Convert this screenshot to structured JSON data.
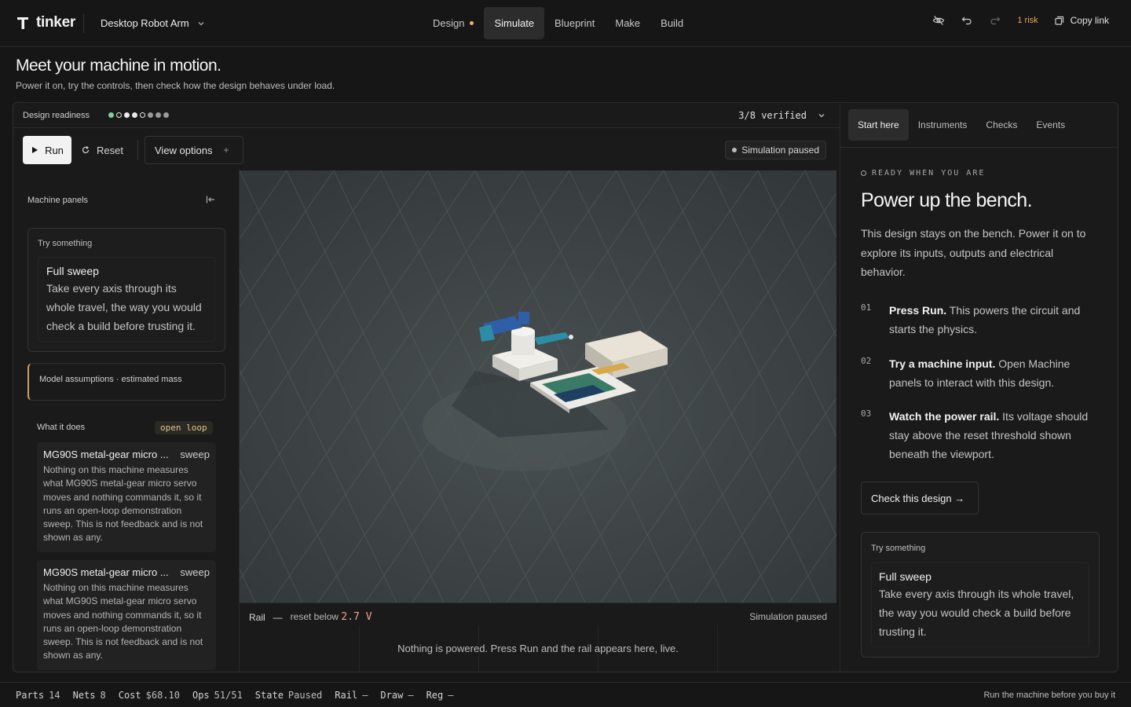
{
  "app": {
    "logo_text": "tinker",
    "project_name": "Desktop Robot Arm"
  },
  "nav": {
    "tabs": [
      {
        "label": "Design",
        "active": false,
        "has_dot": true
      },
      {
        "label": "Simulate",
        "active": true,
        "has_dot": false
      },
      {
        "label": "Blueprint",
        "active": false,
        "has_dot": false
      },
      {
        "label": "Make",
        "active": false,
        "has_dot": false
      },
      {
        "label": "Build",
        "active": false,
        "has_dot": false
      }
    ]
  },
  "toolbar": {
    "icons": [
      "eye-off-icon",
      "undo-icon",
      "redo-icon"
    ],
    "risk_label": "1 risk",
    "copy_link_label": "Copy link"
  },
  "hero": {
    "title": "Meet your machine in motion.",
    "subtitle": "Power it on, try the controls, then check how the design behaves under load."
  },
  "readiness": {
    "label": "Design readiness",
    "verified_text": "3/8 verified",
    "dots": [
      "#7fd09a",
      "#2a2a2a",
      "#e9e9e9",
      "#e9e9e9",
      "#2a2a2a",
      "#9a9a9a",
      "#9a9a9a",
      "#9a9a9a"
    ]
  },
  "controls": {
    "run_label": "Run",
    "reset_label": "Reset",
    "view_options_label": "View options",
    "sim_status": "Simulation paused"
  },
  "sidebar": {
    "header": "Machine panels",
    "try_card": {
      "label": "Try something",
      "title": "Full sweep",
      "description": "Take every axis through its whole travel, the way you would check a build before trusting it."
    },
    "assumptions": "Model assumptions · estimated mass",
    "what_it_does": "What it does",
    "loop_badge": "open loop",
    "servos": [
      {
        "name": "MG90S metal-gear micro ...",
        "tag": "sweep",
        "description": "Nothing on this machine measures what MG90S metal-gear micro servo moves and nothing commands it, so it runs an open-loop demonstration sweep. This is not feedback and is not shown as any."
      },
      {
        "name": "MG90S metal-gear micro ...",
        "tag": "sweep",
        "description": "Nothing on this machine measures what MG90S metal-gear micro servo moves and nothing commands it, so it runs an open-loop demonstration sweep. This is not feedback and is not shown as any."
      }
    ]
  },
  "rail": {
    "label": "Rail",
    "dash": "—",
    "reset_text": "reset below",
    "threshold": "2.7 V",
    "status": "Simulation paused",
    "empty_message": "Nothing is powered. Press Run and the rail appears here, live."
  },
  "right_panel": {
    "tabs": [
      {
        "label": "Start here",
        "active": true
      },
      {
        "label": "Instruments",
        "active": false
      },
      {
        "label": "Checks",
        "active": false
      },
      {
        "label": "Events",
        "active": false
      }
    ],
    "kicker": "READY WHEN YOU ARE",
    "title": "Power up the bench.",
    "intro": "This design stays on the bench. Power it on to explore its inputs, outputs and electrical behavior.",
    "steps": [
      {
        "num": "01",
        "bold": "Press Run.",
        "text": " This powers the circuit and starts the physics."
      },
      {
        "num": "02",
        "bold": "Try a machine input.",
        "text": " Open Machine panels to interact with this design."
      },
      {
        "num": "03",
        "bold": "Watch the power rail.",
        "text": " Its voltage should stay above the reset threshold shown beneath the viewport."
      }
    ],
    "check_button": "Check this design →",
    "try_card": {
      "label": "Try something",
      "title": "Full sweep",
      "description": "Take every axis through its whole travel, the way you would check a build before trusting it."
    }
  },
  "statusbar": {
    "stats": [
      {
        "key": "Parts",
        "value": "14"
      },
      {
        "key": "Nets",
        "value": "8"
      },
      {
        "key": "Cost",
        "value": "$68.10"
      },
      {
        "key": "Ops",
        "value": "51/51"
      },
      {
        "key": "State",
        "value": "Paused"
      },
      {
        "key": "Rail",
        "value": "—"
      },
      {
        "key": "Draw",
        "value": "—"
      },
      {
        "key": "Reg",
        "value": "—"
      }
    ],
    "note": "Run the machine before you buy it"
  }
}
